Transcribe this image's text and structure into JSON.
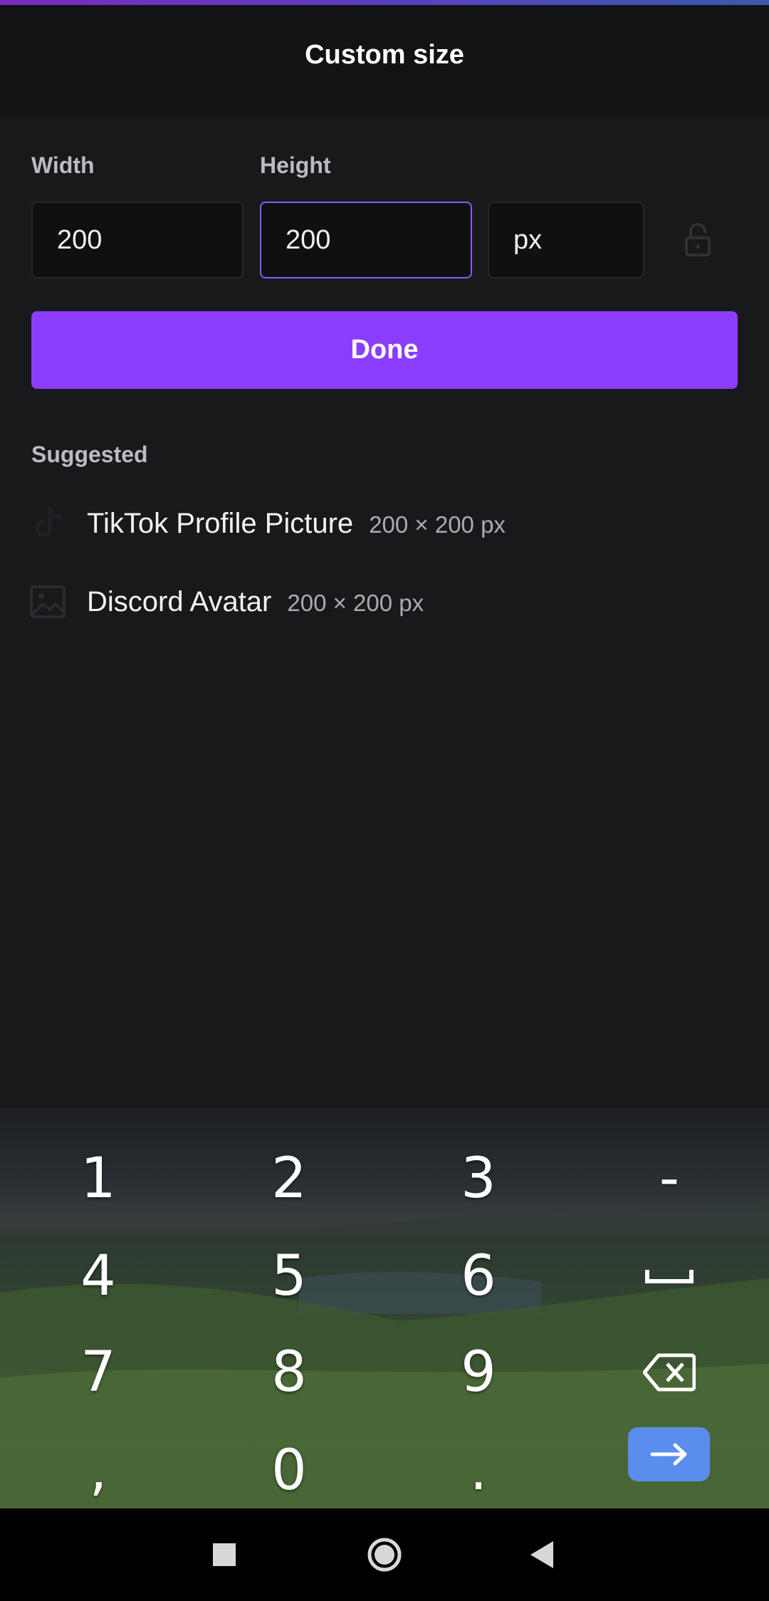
{
  "header": {
    "title": "Custom size"
  },
  "form": {
    "width_label": "Width",
    "height_label": "Height",
    "width_value": "200",
    "height_value": "200",
    "unit_value": "px",
    "lock_icon": "lock-open-icon"
  },
  "done_label": "Done",
  "suggested": {
    "label": "Suggested",
    "items": [
      {
        "name": "TikTok Profile Picture",
        "size": "200 × 200 px",
        "icon": "tiktok-icon"
      },
      {
        "name": "Discord Avatar",
        "size": "200 × 200 px",
        "icon": "image-icon"
      }
    ]
  },
  "keyboard": {
    "keys": [
      "1",
      "2",
      "3",
      "-",
      "4",
      "5",
      "6",
      "␣",
      "7",
      "8",
      "9",
      "backspace",
      ",",
      "0",
      ".",
      "enter"
    ],
    "enter_icon": "arrow-right-icon",
    "backspace_icon": "backspace-icon",
    "space_icon": "space-icon"
  },
  "navbar": {
    "recents_icon": "square-icon",
    "home_icon": "circle-icon",
    "back_icon": "triangle-back-icon"
  },
  "colors": {
    "accent": "#8b3dff",
    "focus_border": "#8b5cf6",
    "enter_key": "#5b8def",
    "background": "#18191b",
    "header": "#121314"
  }
}
